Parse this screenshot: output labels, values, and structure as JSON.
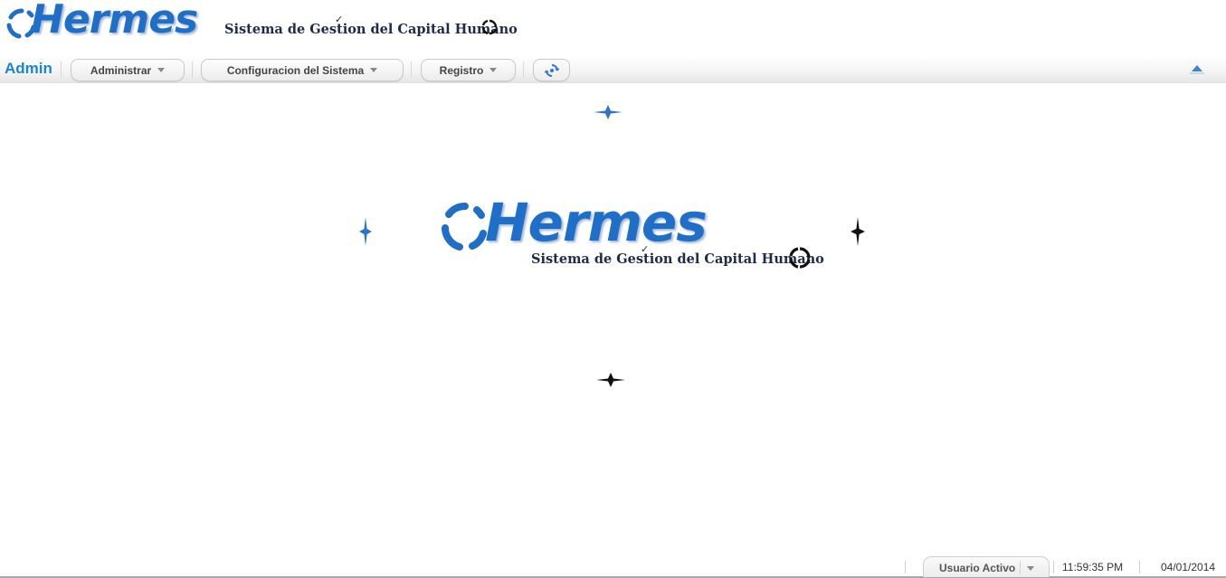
{
  "header": {
    "logo_word": "Hermes",
    "logo_subtitle": "Sistema de Gestion del Capital Humano"
  },
  "menubar": {
    "user_role": "Admin",
    "menus": [
      {
        "label": "Administrar"
      },
      {
        "label": "Configuracion del Sistema"
      },
      {
        "label": "Registro"
      }
    ],
    "refresh_icon": "refresh-icon",
    "collapse_icon": "triangle-up-icon"
  },
  "splash": {
    "logo_word": "Hermes",
    "logo_subtitle": "Sistema de Gestion del Capital Humano"
  },
  "statusbar": {
    "user_status": "Usuario Activo",
    "time": "11:59:35 PM",
    "date": "04/01/2014"
  },
  "colors": {
    "brand_blue": "#1f6fc8",
    "admin_blue": "#1a86d0",
    "sparkle_blue": "#2e74c9",
    "sparkle_black": "#111111"
  }
}
